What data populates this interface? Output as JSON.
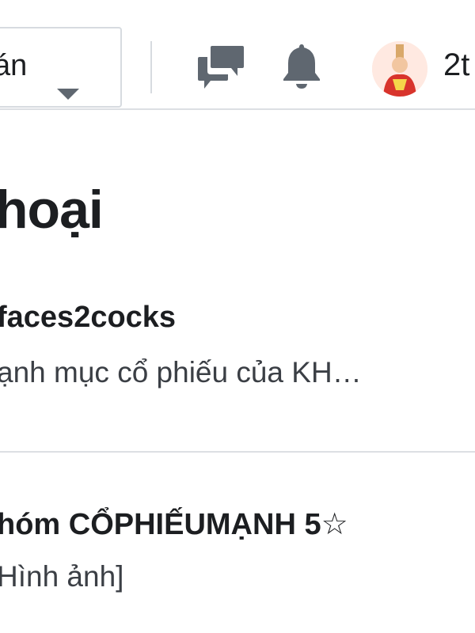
{
  "header": {
    "menu_select_label": "án",
    "icons": {
      "chat": "chat-icon",
      "bell": "bell-icon",
      "dropdown": "chevron-down-icon"
    },
    "user_count": "2t"
  },
  "page": {
    "title": "hoại"
  },
  "threads": [
    {
      "title": "faces2cocks",
      "snippet": "ạnh mục cổ phiếu của KH…"
    },
    {
      "title": "hóm CỔPHIẾUMẠNH 5☆",
      "snippet": "Hình ảnh]"
    }
  ],
  "colors": {
    "text": "#1c1e21",
    "icon": "#5f6770",
    "border": "#dcdfe3",
    "avatar_bg": "#ffe9e1"
  }
}
